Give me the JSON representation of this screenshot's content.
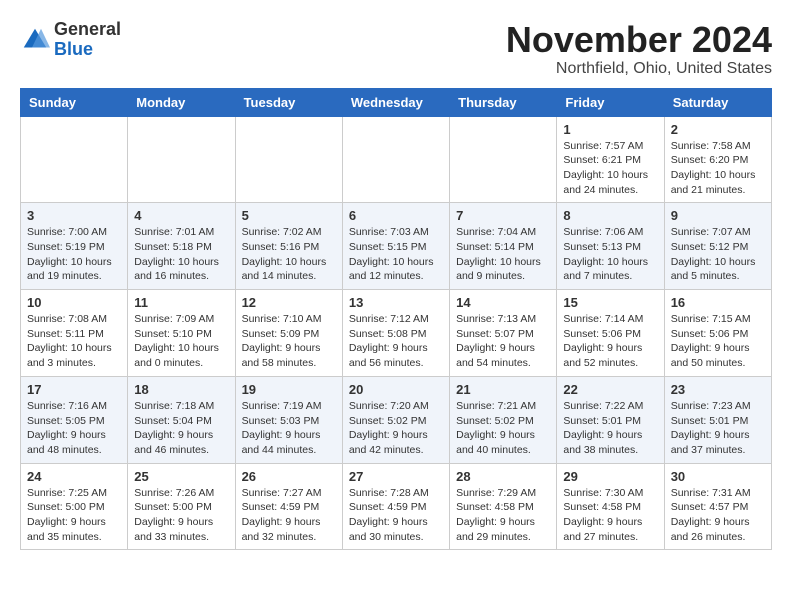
{
  "logo": {
    "general": "General",
    "blue": "Blue"
  },
  "header": {
    "month": "November 2024",
    "location": "Northfield, Ohio, United States"
  },
  "weekdays": [
    "Sunday",
    "Monday",
    "Tuesday",
    "Wednesday",
    "Thursday",
    "Friday",
    "Saturday"
  ],
  "rows": [
    [
      {
        "day": "",
        "info": ""
      },
      {
        "day": "",
        "info": ""
      },
      {
        "day": "",
        "info": ""
      },
      {
        "day": "",
        "info": ""
      },
      {
        "day": "",
        "info": ""
      },
      {
        "day": "1",
        "info": "Sunrise: 7:57 AM\nSunset: 6:21 PM\nDaylight: 10 hours and 24 minutes."
      },
      {
        "day": "2",
        "info": "Sunrise: 7:58 AM\nSunset: 6:20 PM\nDaylight: 10 hours and 21 minutes."
      }
    ],
    [
      {
        "day": "3",
        "info": "Sunrise: 7:00 AM\nSunset: 5:19 PM\nDaylight: 10 hours and 19 minutes."
      },
      {
        "day": "4",
        "info": "Sunrise: 7:01 AM\nSunset: 5:18 PM\nDaylight: 10 hours and 16 minutes."
      },
      {
        "day": "5",
        "info": "Sunrise: 7:02 AM\nSunset: 5:16 PM\nDaylight: 10 hours and 14 minutes."
      },
      {
        "day": "6",
        "info": "Sunrise: 7:03 AM\nSunset: 5:15 PM\nDaylight: 10 hours and 12 minutes."
      },
      {
        "day": "7",
        "info": "Sunrise: 7:04 AM\nSunset: 5:14 PM\nDaylight: 10 hours and 9 minutes."
      },
      {
        "day": "8",
        "info": "Sunrise: 7:06 AM\nSunset: 5:13 PM\nDaylight: 10 hours and 7 minutes."
      },
      {
        "day": "9",
        "info": "Sunrise: 7:07 AM\nSunset: 5:12 PM\nDaylight: 10 hours and 5 minutes."
      }
    ],
    [
      {
        "day": "10",
        "info": "Sunrise: 7:08 AM\nSunset: 5:11 PM\nDaylight: 10 hours and 3 minutes."
      },
      {
        "day": "11",
        "info": "Sunrise: 7:09 AM\nSunset: 5:10 PM\nDaylight: 10 hours and 0 minutes."
      },
      {
        "day": "12",
        "info": "Sunrise: 7:10 AM\nSunset: 5:09 PM\nDaylight: 9 hours and 58 minutes."
      },
      {
        "day": "13",
        "info": "Sunrise: 7:12 AM\nSunset: 5:08 PM\nDaylight: 9 hours and 56 minutes."
      },
      {
        "day": "14",
        "info": "Sunrise: 7:13 AM\nSunset: 5:07 PM\nDaylight: 9 hours and 54 minutes."
      },
      {
        "day": "15",
        "info": "Sunrise: 7:14 AM\nSunset: 5:06 PM\nDaylight: 9 hours and 52 minutes."
      },
      {
        "day": "16",
        "info": "Sunrise: 7:15 AM\nSunset: 5:06 PM\nDaylight: 9 hours and 50 minutes."
      }
    ],
    [
      {
        "day": "17",
        "info": "Sunrise: 7:16 AM\nSunset: 5:05 PM\nDaylight: 9 hours and 48 minutes."
      },
      {
        "day": "18",
        "info": "Sunrise: 7:18 AM\nSunset: 5:04 PM\nDaylight: 9 hours and 46 minutes."
      },
      {
        "day": "19",
        "info": "Sunrise: 7:19 AM\nSunset: 5:03 PM\nDaylight: 9 hours and 44 minutes."
      },
      {
        "day": "20",
        "info": "Sunrise: 7:20 AM\nSunset: 5:02 PM\nDaylight: 9 hours and 42 minutes."
      },
      {
        "day": "21",
        "info": "Sunrise: 7:21 AM\nSunset: 5:02 PM\nDaylight: 9 hours and 40 minutes."
      },
      {
        "day": "22",
        "info": "Sunrise: 7:22 AM\nSunset: 5:01 PM\nDaylight: 9 hours and 38 minutes."
      },
      {
        "day": "23",
        "info": "Sunrise: 7:23 AM\nSunset: 5:01 PM\nDaylight: 9 hours and 37 minutes."
      }
    ],
    [
      {
        "day": "24",
        "info": "Sunrise: 7:25 AM\nSunset: 5:00 PM\nDaylight: 9 hours and 35 minutes."
      },
      {
        "day": "25",
        "info": "Sunrise: 7:26 AM\nSunset: 5:00 PM\nDaylight: 9 hours and 33 minutes."
      },
      {
        "day": "26",
        "info": "Sunrise: 7:27 AM\nSunset: 4:59 PM\nDaylight: 9 hours and 32 minutes."
      },
      {
        "day": "27",
        "info": "Sunrise: 7:28 AM\nSunset: 4:59 PM\nDaylight: 9 hours and 30 minutes."
      },
      {
        "day": "28",
        "info": "Sunrise: 7:29 AM\nSunset: 4:58 PM\nDaylight: 9 hours and 29 minutes."
      },
      {
        "day": "29",
        "info": "Sunrise: 7:30 AM\nSunset: 4:58 PM\nDaylight: 9 hours and 27 minutes."
      },
      {
        "day": "30",
        "info": "Sunrise: 7:31 AM\nSunset: 4:57 PM\nDaylight: 9 hours and 26 minutes."
      }
    ]
  ]
}
